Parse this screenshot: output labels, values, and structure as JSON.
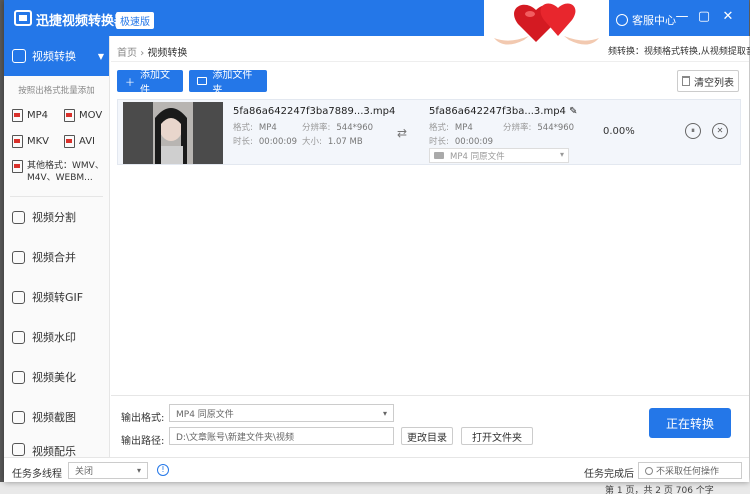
{
  "window": {
    "app_title": "迅捷视频转换器",
    "edition_badge": "极速版",
    "support_label": "客服中心",
    "minimize_glyph": "—",
    "maximize_glyph": "▢",
    "close_glyph": "✕"
  },
  "ad": {
    "image": "hearts-hands",
    "caption": "频转换：视频格式转换,从视频提取音频"
  },
  "sidebar": {
    "active_item": "视频转换",
    "hint": "按照出格式批量添加",
    "formats": [
      "MP4",
      "MOV",
      "MKV",
      "AVI"
    ],
    "other_formats": [
      "其他格式：WMV、",
      "M4V、WEBM..."
    ],
    "items": [
      {
        "label": "视频分割",
        "icon": "split-icon"
      },
      {
        "label": "视频合并",
        "icon": "merge-icon"
      },
      {
        "label": "视频转GIF",
        "icon": "gif-icon"
      },
      {
        "label": "视频水印",
        "icon": "watermark-icon"
      },
      {
        "label": "视频美化",
        "icon": "beautify-icon"
      },
      {
        "label": "视频截图",
        "icon": "screenshot-icon"
      },
      {
        "label": "视频配乐",
        "icon": "music-icon"
      }
    ]
  },
  "breadcrumb": {
    "home": "首页",
    "sep": "›",
    "current": "视频转换"
  },
  "toolbar": {
    "add_file": "添加文件",
    "add_folder": "添加文件夹",
    "clear_list": "清空列表"
  },
  "file": {
    "source_name": "5fa86a642247f3ba7889...3.mp4",
    "source_format_label": "格式:",
    "source_format": "MP4",
    "source_res_label": "分辨率:",
    "source_res": "544*960",
    "source_dur_label": "时长:",
    "source_dur": "00:00:09",
    "source_size_label": "大小:",
    "source_size": "1.07 MB",
    "target_name": "5fa86a642247f3ba...3.mp4",
    "target_format_label": "格式:",
    "target_format": "MP4",
    "target_res_label": "分辨率:",
    "target_res": "544*960",
    "target_dur_label": "时长:",
    "target_dur": "00:00:09",
    "target_select": "MP4  同原文件",
    "progress": "0.00%",
    "pause_glyph": "⏸",
    "remove_glyph": "✕"
  },
  "output": {
    "format_label": "输出格式:",
    "format_value": "MP4  同原文件",
    "path_label": "输出路径:",
    "path_value": "D:\\文章账号\\新建文件夹\\视频",
    "change_dir": "更改目录",
    "open_folder": "打开文件夹",
    "convert": "正在转换"
  },
  "status": {
    "multithread_label": "任务多线程",
    "multithread_value": "关闭",
    "after_label": "任务完成后",
    "after_value": "不采取任何操作"
  },
  "background": {
    "bottom_text": "第 1 页，共 2 页    706 个字"
  }
}
